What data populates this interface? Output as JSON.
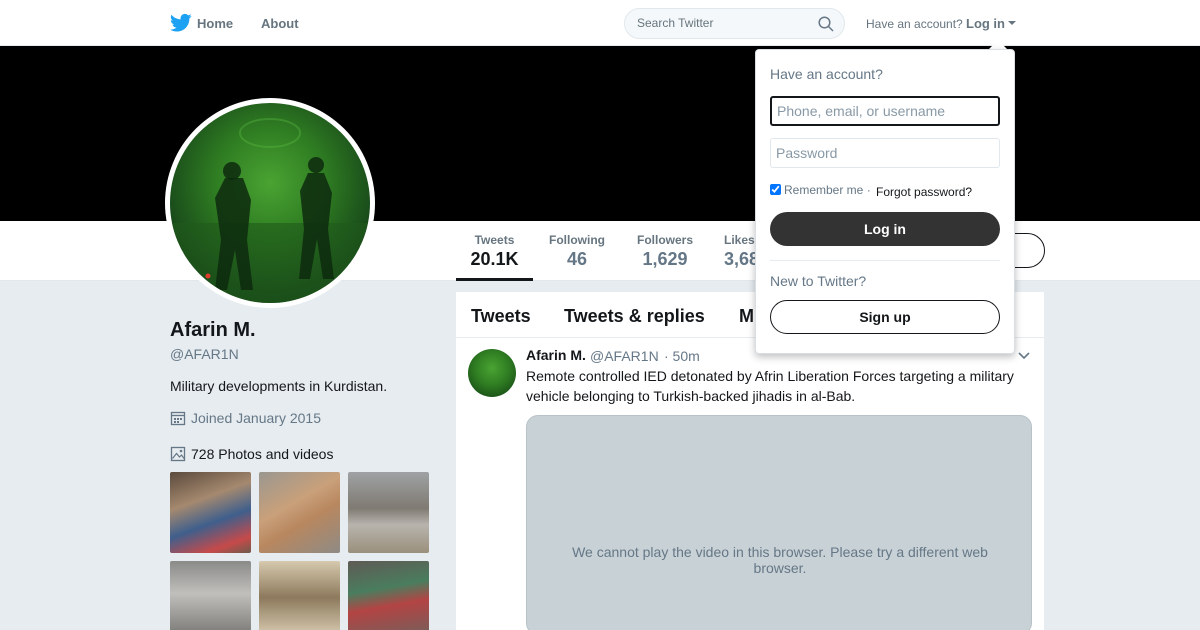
{
  "nav": {
    "home_label": "Home",
    "about_label": "About",
    "search_placeholder": "Search Twitter",
    "have_account": "Have an account?",
    "login_label": "Log in",
    "logo_icon": "twitter-bird-icon",
    "brand_color": "#1da1f2"
  },
  "profile": {
    "name": "Afarin M.",
    "handle": "@AFAR1N",
    "bio": "Military developments in Kurdistan.",
    "joined": "Joined January 2015",
    "photos_label": "728 Photos and videos"
  },
  "stats": [
    {
      "label": "Tweets",
      "value": "20.1K"
    },
    {
      "label": "Following",
      "value": "46"
    },
    {
      "label": "Followers",
      "value": "1,629"
    },
    {
      "label": "Likes",
      "value": "3,68"
    }
  ],
  "timeline": {
    "tabs": [
      "Tweets",
      "Tweets & replies",
      "M"
    ],
    "tweet": {
      "name": "Afarin M.",
      "handle": "@AFAR1N",
      "time": "· 50m",
      "text": "Remote controlled IED detonated by Afrin Liberation Forces targeting a military vehicle belonging to Turkish-backed jihadis in al-Bab.",
      "video_message": "We cannot play the video in this browser. Please try a different web browser."
    }
  },
  "login_dropdown": {
    "title": "Have an account?",
    "username_placeholder": "Phone, email, or username",
    "password_placeholder": "Password",
    "remember_me": "Remember me",
    "separator": "·",
    "forgot_password": "Forgot password?",
    "login_button": "Log in",
    "new_to": "New to Twitter?",
    "signup_button": "Sign up"
  }
}
